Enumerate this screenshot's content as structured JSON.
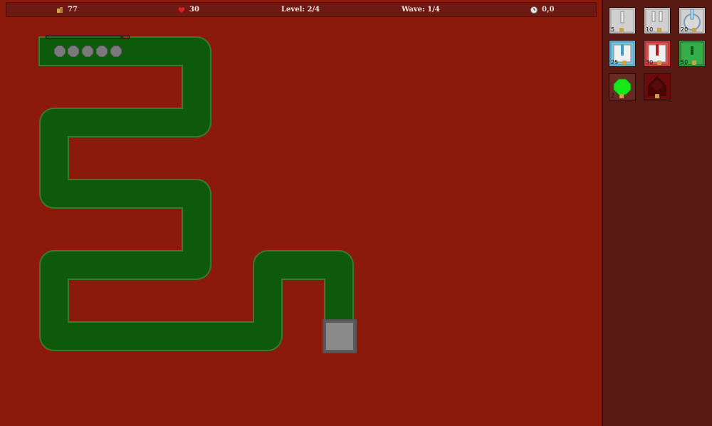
{
  "hud": {
    "gold": "77",
    "lives": "30",
    "level": "Level: 2/4",
    "wave": "Wave: 1/4",
    "time": "0,0"
  },
  "towers": [
    {
      "cost": "5",
      "icon": "single-cannon-tower-icon"
    },
    {
      "cost": "10",
      "icon": "double-cannon-tower-icon"
    },
    {
      "cost": "20",
      "icon": "round-cannon-tower-icon"
    },
    {
      "cost": "25",
      "icon": "ice-tower-icon"
    },
    {
      "cost": "30",
      "icon": "fire-tower-icon"
    },
    {
      "cost": "50",
      "icon": "poison-tower-icon"
    },
    {
      "cost": "2",
      "icon": "green-octagon-tower-icon"
    },
    {
      "cost": "",
      "icon": "dark-upgrade-tower-icon"
    }
  ],
  "colors": {
    "background": "#8b1a0a",
    "path": "#0d5a0a",
    "sidebar": "#5a1a14",
    "enemy": "#7a7a7a"
  },
  "enemies": {
    "count": 5,
    "health_fraction": 0.9
  }
}
